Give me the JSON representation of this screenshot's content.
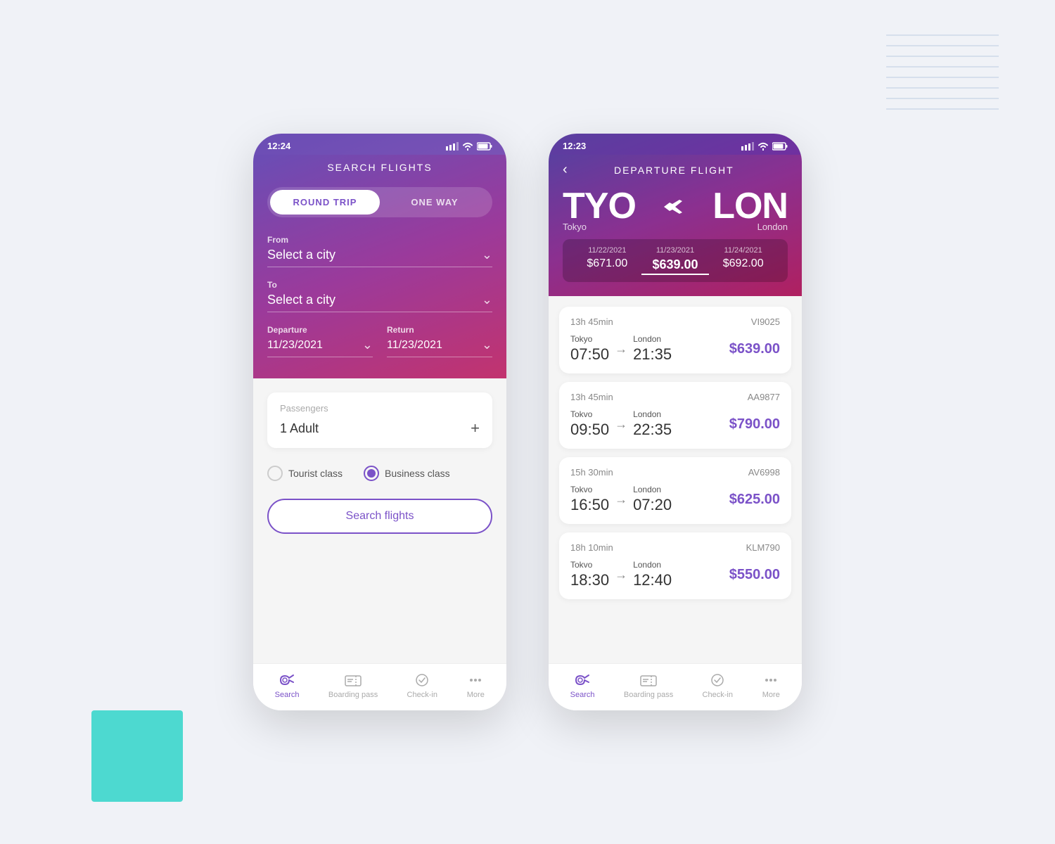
{
  "leftPhone": {
    "statusBar": {
      "time": "12:24",
      "signal": "▋▋▋",
      "wifi": "wifi",
      "battery": "battery"
    },
    "header": {
      "title": "SEARCH FLIGHTS",
      "roundTripLabel": "ROUND TRIP",
      "oneWayLabel": "ONE WAY",
      "fromLabel": "From",
      "fromPlaceholder": "Select a city",
      "toLabel": "To",
      "toPlaceholder": "Select a city",
      "departureLabel": "Departure",
      "departureDate": "11/23/2021",
      "returnLabel": "Return",
      "returnDate": "11/23/2021"
    },
    "body": {
      "passengersLabel": "Passengers",
      "passengersValue": "1 Adult",
      "touristLabel": "Tourist class",
      "businessLabel": "Business class",
      "searchBtn": "Search flights"
    },
    "bottomNav": {
      "items": [
        {
          "label": "Search",
          "active": true,
          "icon": "plane"
        },
        {
          "label": "Boarding pass",
          "active": false,
          "icon": "ticket"
        },
        {
          "label": "Check-in",
          "active": false,
          "icon": "check"
        },
        {
          "label": "More",
          "active": false,
          "icon": "dots"
        }
      ]
    }
  },
  "rightPhone": {
    "statusBar": {
      "time": "12:23"
    },
    "header": {
      "title": "DEPARTURE FLIGHT",
      "originCode": "TYO",
      "originCity": "Tokyo",
      "destCode": "LON",
      "destCity": "London",
      "dates": [
        {
          "date": "11/22/2021",
          "price": "$671.00",
          "selected": false
        },
        {
          "date": "11/23/2021",
          "price": "$639.00",
          "selected": true
        },
        {
          "date": "11/24/2021",
          "price": "$692.00",
          "selected": false
        }
      ]
    },
    "flights": [
      {
        "duration": "13h 45min",
        "code": "VI9025",
        "originCity": "Tokyo",
        "destCity": "London",
        "departure": "07:50",
        "arrival": "21:35",
        "price": "$639.00"
      },
      {
        "duration": "13h 45min",
        "code": "AA9877",
        "originCity": "Tokvo",
        "destCity": "London",
        "departure": "09:50",
        "arrival": "22:35",
        "price": "$790.00"
      },
      {
        "duration": "15h 30min",
        "code": "AV6998",
        "originCity": "Tokvo",
        "destCity": "London",
        "departure": "16:50",
        "arrival": "07:20",
        "price": "$625.00"
      },
      {
        "duration": "18h 10min",
        "code": "KLM790",
        "originCity": "Tokvo",
        "destCity": "London",
        "departure": "18:30",
        "arrival": "12:40",
        "price": "$550.00"
      }
    ],
    "bottomNav": {
      "items": [
        {
          "label": "Search",
          "active": true,
          "icon": "plane"
        },
        {
          "label": "Boarding pass",
          "active": false,
          "icon": "ticket"
        },
        {
          "label": "Check-in",
          "active": false,
          "icon": "check"
        },
        {
          "label": "More",
          "active": false,
          "icon": "dots"
        }
      ]
    }
  }
}
